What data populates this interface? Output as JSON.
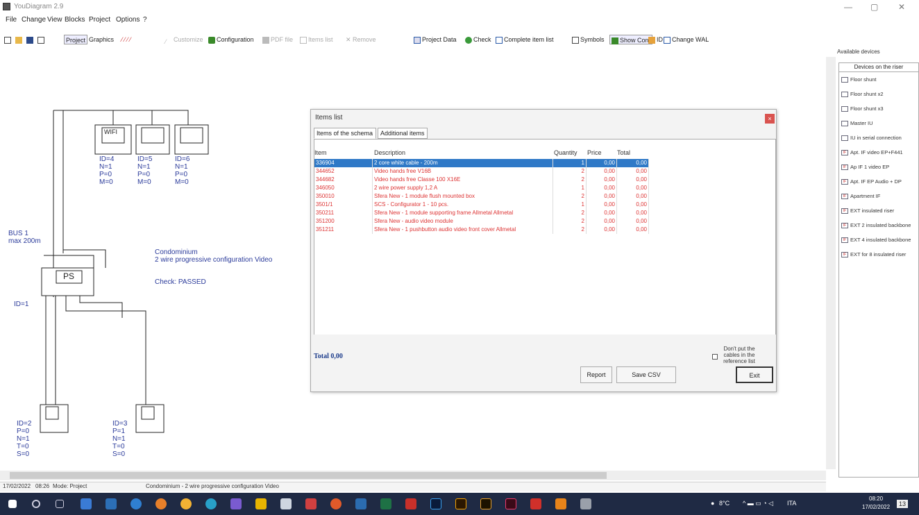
{
  "window": {
    "title": "YouDiagram 2.9",
    "min": "—",
    "max": "▢",
    "close": "✕"
  },
  "menu": [
    "File",
    "Change",
    "View",
    "Blocks",
    "Project",
    "Options",
    "?"
  ],
  "toolbar": {
    "project": "Project",
    "graphics": "Graphics",
    "customize": "Customize",
    "configuration": "Configuration",
    "pdf": "PDF file",
    "items": "Items list",
    "remove": "Remove",
    "project_data": "Project Data",
    "check": "Check",
    "complete": "Complete item list",
    "symbols": "Symbols",
    "show_conf": "Show Conf",
    "id": "ID",
    "change_wal": "Change WAL"
  },
  "diagram": {
    "wifi": "WIFI",
    "dev_top": [
      {
        "lines": "ID=4\nN=1\nP=0\nM=0"
      },
      {
        "lines": "ID=5\nN=1\nP=0\nM=0"
      },
      {
        "lines": "ID=6\nN=1\nP=0\nM=0"
      }
    ],
    "bus": "BUS 1\nmax 200m",
    "ps": "PS",
    "ps_id": "ID=1",
    "info": "Condominium\n2 wire progressive configuration Video",
    "check": "Check: PASSED",
    "dev_bottom": [
      {
        "lines": "ID=2\nP=0\nN=1\nT=0\nS=0"
      },
      {
        "lines": "ID=3\nP=1\nN=1\nT=0\nS=0"
      }
    ]
  },
  "dialog": {
    "title": "Items list",
    "close": "×",
    "tabs": [
      "Items of the schema",
      "Additional items"
    ],
    "headers": {
      "item": "Item",
      "desc": "Description",
      "qty": "Quantity",
      "price": "Price",
      "total": "Total"
    },
    "rows": [
      {
        "item": "336904",
        "desc": "2 core white cable - 200m",
        "qty": "1",
        "price": "0,00",
        "total": "0,00"
      },
      {
        "item": "344652",
        "desc": "Video hands free V16B",
        "qty": "2",
        "price": "0,00",
        "total": "0,00"
      },
      {
        "item": "344682",
        "desc": "Video hands free Classe 100 X16E",
        "qty": "2",
        "price": "0,00",
        "total": "0,00"
      },
      {
        "item": "346050",
        "desc": "2 wire power supply 1,2 A",
        "qty": "1",
        "price": "0,00",
        "total": "0,00"
      },
      {
        "item": "350010",
        "desc": "Sfera New - 1 module  flush mounted box",
        "qty": "2",
        "price": "0,00",
        "total": "0,00"
      },
      {
        "item": "3501/1",
        "desc": "SCS - Configurator 1 - 10 pcs.",
        "qty": "1",
        "price": "0,00",
        "total": "0,00"
      },
      {
        "item": "350211",
        "desc": "Sfera New - 1 module supporting frame Allmetal Allmetal",
        "qty": "2",
        "price": "0,00",
        "total": "0,00"
      },
      {
        "item": "351200",
        "desc": "Sfera New - audio video module",
        "qty": "2",
        "price": "0,00",
        "total": "0,00"
      },
      {
        "item": "351211",
        "desc": "Sfera New - 1 pushbutton audio video front cover Allmetal",
        "qty": "2",
        "price": "0,00",
        "total": "0,00"
      }
    ],
    "total": "Total  0,00",
    "checkbox_label": "Don't put the\ncables in the\nreference list",
    "report": "Report",
    "save_csv": "Save CSV",
    "exit": "Exit"
  },
  "right_panel": {
    "header": "Available devices",
    "tab": "Devices on the riser",
    "devices": [
      "Floor shunt",
      "Floor shunt x2",
      "Floor shunt x3",
      "Master IU",
      "IU in serial connection",
      "Apt. IF video EP+F441",
      "Ap IF 1 video EP",
      "Apt. IF EP Audio + DP",
      "Apartment IF",
      "EXT insulated riser",
      "EXT 2 insulated backbone",
      "EXT 4 insulated backbone",
      "EXT for 8 insulated riser"
    ]
  },
  "status": {
    "date": "17/02/2022",
    "time": "08:26",
    "mode": "Mode: Project",
    "info": "Condominium - 2 wire progressive configuration Video"
  },
  "taskbar": {
    "weather": "8°C",
    "lang": "ITA",
    "clock_time": "08:20",
    "clock_date": "17/02/2022",
    "notif": "13"
  }
}
